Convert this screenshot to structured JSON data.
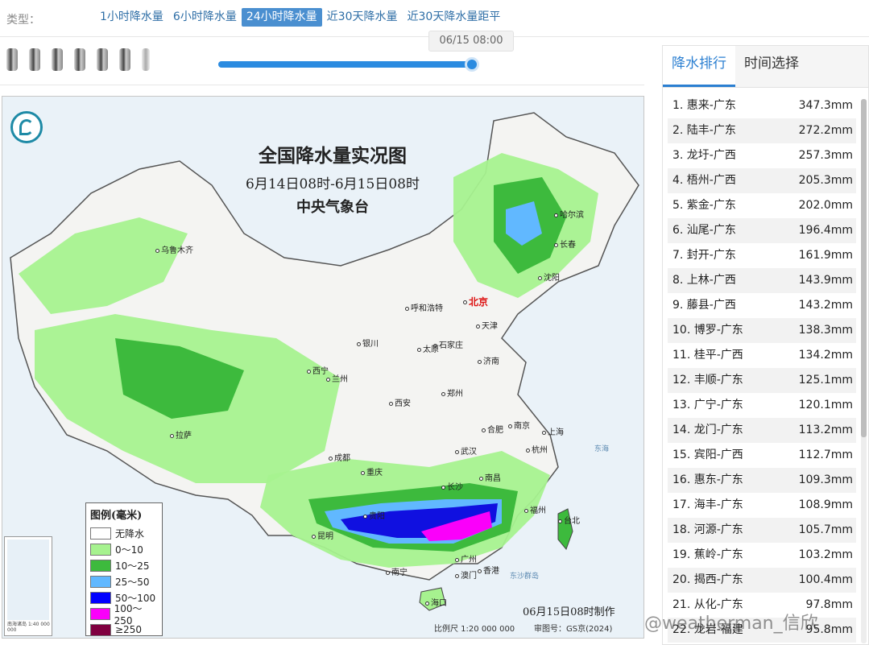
{
  "typebar": {
    "label": "类型：",
    "tabs": [
      "1小时降水量",
      "6小时降水量",
      "24小时降水量",
      "近30天降水量",
      "近30天降水量距平"
    ],
    "active_index": 2
  },
  "timeline": {
    "tooltip": "06/15 08:00",
    "progress": 1.0
  },
  "map": {
    "title": "全国降水量实况图",
    "period": "6月14日08时-6月15日08时",
    "agency": "中央气象台",
    "made_text": "06月15日08时制作",
    "scale_text": "比例尺 1:20 000 000",
    "approval_text": "审图号：GS京(2024)",
    "inset_scale": "1:40 000 000",
    "inset_label": "南海诸岛",
    "capital": "北京",
    "cities": [
      "乌鲁木齐",
      "哈尔滨",
      "长春",
      "沈阳",
      "呼和浩特",
      "天津",
      "石家庄",
      "太原",
      "银川",
      "济南",
      "西宁",
      "兰州",
      "郑州",
      "西安",
      "合肥",
      "南京",
      "上海",
      "武汉",
      "杭州",
      "拉萨",
      "成都",
      "重庆",
      "长沙",
      "南昌",
      "福州",
      "贵阳",
      "昆明",
      "台北",
      "广州",
      "香港",
      "澳门",
      "南宁",
      "海口"
    ],
    "seas": [
      "东海",
      "东沙群岛"
    ],
    "legend": {
      "title": "图例(毫米)",
      "items": [
        {
          "label": "无降水",
          "color": "#ffffff"
        },
        {
          "label": "0～10",
          "color": "#a6f28f"
        },
        {
          "label": "10～25",
          "color": "#3dba3d"
        },
        {
          "label": "25～50",
          "color": "#61b8ff"
        },
        {
          "label": "50～100",
          "color": "#0000ff"
        },
        {
          "label": "100～250",
          "color": "#fa00fa"
        },
        {
          "label": "≥250",
          "color": "#800040"
        }
      ]
    }
  },
  "panel": {
    "tabs": [
      "降水排行",
      "时间选择"
    ],
    "active_tab": 0,
    "ranking": [
      {
        "name": "1. 惠来-广东",
        "value": "347.3mm"
      },
      {
        "name": "2. 陆丰-广东",
        "value": "272.2mm"
      },
      {
        "name": "3. 龙圩-广西",
        "value": "257.3mm"
      },
      {
        "name": "4. 梧州-广西",
        "value": "205.3mm"
      },
      {
        "name": "5. 紫金-广东",
        "value": "202.0mm"
      },
      {
        "name": "6. 汕尾-广东",
        "value": "196.4mm"
      },
      {
        "name": "7. 封开-广东",
        "value": "161.9mm"
      },
      {
        "name": "8. 上林-广西",
        "value": "143.9mm"
      },
      {
        "name": "9. 藤县-广西",
        "value": "143.2mm"
      },
      {
        "name": "10. 博罗-广东",
        "value": "138.3mm"
      },
      {
        "name": "11. 桂平-广西",
        "value": "134.2mm"
      },
      {
        "name": "12. 丰顺-广东",
        "value": "125.1mm"
      },
      {
        "name": "13. 广宁-广东",
        "value": "120.1mm"
      },
      {
        "name": "14. 龙门-广东",
        "value": "113.2mm"
      },
      {
        "name": "15. 宾阳-广西",
        "value": "112.7mm"
      },
      {
        "name": "16. 惠东-广东",
        "value": "109.3mm"
      },
      {
        "name": "17. 海丰-广东",
        "value": "108.9mm"
      },
      {
        "name": "18. 河源-广东",
        "value": "105.7mm"
      },
      {
        "name": "19. 蕉岭-广东",
        "value": "103.2mm"
      },
      {
        "name": "20. 揭西-广东",
        "value": "100.4mm"
      },
      {
        "name": "21. 从化-广东",
        "value": "97.8mm"
      },
      {
        "name": "22. 龙岩-福建",
        "value": "95.8mm"
      }
    ]
  },
  "watermark": "@weatherman_信欣"
}
